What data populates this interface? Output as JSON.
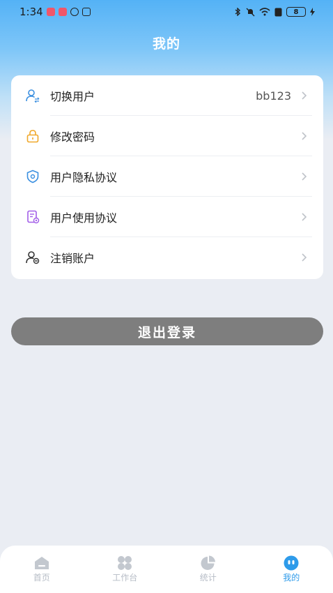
{
  "status_bar": {
    "time": "1:34",
    "battery": "8"
  },
  "header": {
    "title": "我的"
  },
  "menu": {
    "items": [
      {
        "label": "切换用户",
        "value": "bb123",
        "icon": "user-switch-icon"
      },
      {
        "label": "修改密码",
        "value": "",
        "icon": "lock-icon"
      },
      {
        "label": "用户隐私协议",
        "value": "",
        "icon": "shield-icon"
      },
      {
        "label": "用户使用协议",
        "value": "",
        "icon": "document-icon"
      },
      {
        "label": "注销账户",
        "value": "",
        "icon": "user-remove-icon"
      }
    ]
  },
  "logout": {
    "label": "退出登录"
  },
  "tabbar": {
    "tabs": [
      {
        "label": "首页",
        "icon": "home-icon",
        "active": false
      },
      {
        "label": "工作台",
        "icon": "grid-icon",
        "active": false
      },
      {
        "label": "统计",
        "icon": "pie-chart-icon",
        "active": false
      },
      {
        "label": "我的",
        "icon": "profile-face-icon",
        "active": true
      }
    ]
  },
  "colors": {
    "accent": "#2e9bea",
    "header_top": "#54b2f6",
    "logout_button": "#7e7e7e",
    "inactive_tab": "#b6bcc6"
  }
}
